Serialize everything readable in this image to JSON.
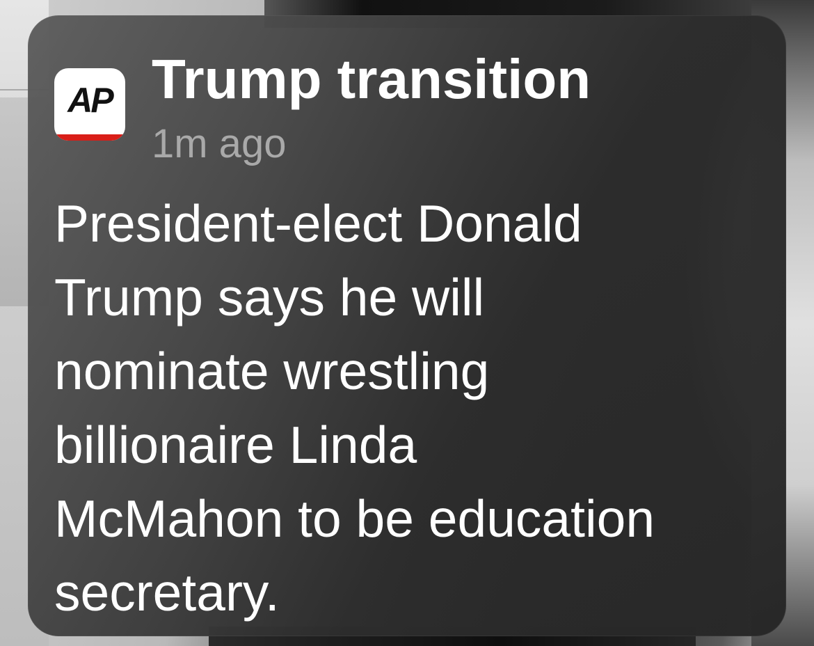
{
  "notification": {
    "app_icon": {
      "icon_name": "ap-app-icon",
      "label": "AP",
      "bar_color": "#d91e18"
    },
    "title": "Trump transition",
    "timestamp": "1m ago",
    "body_lines": [
      "President-elect Donald",
      "Trump says he will",
      "nominate wrestling",
      "billionaire Linda",
      "McMahon to be education",
      "secretary."
    ]
  }
}
